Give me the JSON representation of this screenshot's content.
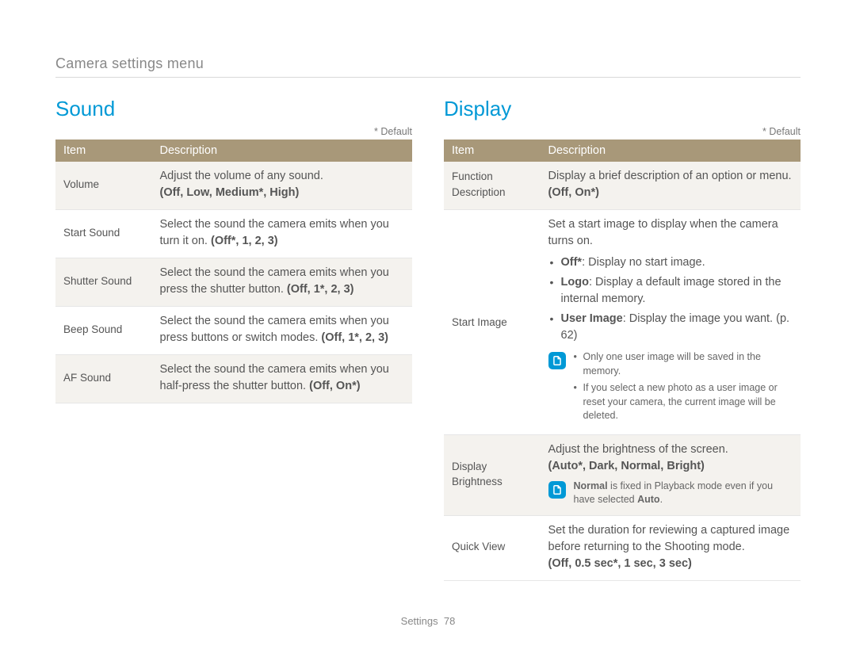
{
  "breadcrumb": "Camera settings menu",
  "default_label": "* Default",
  "headers": {
    "item": "Item",
    "desc": "Description"
  },
  "sound": {
    "title": "Sound",
    "rows": [
      {
        "item": "Volume",
        "desc": "Adjust the volume of any sound.",
        "opts": "(Off, Low, Medium*, High)"
      },
      {
        "item": "Start Sound",
        "desc": "Select the sound the camera emits when you turn it on. ",
        "opts_inline": "(Off*, 1, 2, 3)"
      },
      {
        "item": "Shutter Sound",
        "desc": "Select the sound the camera emits when you press the shutter button. ",
        "opts_inline": "(Off, 1*, 2, 3)"
      },
      {
        "item": "Beep Sound",
        "desc": "Select the sound the camera emits when you press buttons or switch modes. ",
        "opts_inline": "(Off, 1*, 2, 3)"
      },
      {
        "item": "AF Sound",
        "desc": "Select the sound the camera emits when you half-press the shutter button. ",
        "opts_inline": "(Off, On*)"
      }
    ]
  },
  "display": {
    "title": "Display",
    "func_desc": {
      "item": "Function Description",
      "desc": "Display a brief description of an option or menu.",
      "opts": "(Off, On*)"
    },
    "start_image": {
      "item": "Start Image",
      "intro": "Set a start image to display when the camera turns on.",
      "b1_label": "Off*",
      "b1_text": ": Display no start image.",
      "b2_label": "Logo",
      "b2_text": ": Display a default image stored in the internal memory.",
      "b3_label": "User Image",
      "b3_text": ": Display the image you want. (p. 62)",
      "n1": "Only one user image will be saved in the memory.",
      "n2": "If you select a new photo as a user image or reset your camera, the current image will be deleted."
    },
    "brightness": {
      "item": "Display Brightness",
      "desc": "Adjust the brightness of the screen.",
      "opts": "(Auto*, Dark, Normal, Bright)",
      "note_pre": "Normal",
      "note_mid": " is fixed in Playback mode even if you have selected ",
      "note_post": "Auto",
      "note_end": "."
    },
    "quickview": {
      "item": "Quick View",
      "desc": "Set the duration for reviewing a captured image before returning to the Shooting mode.",
      "opts": "(Off, 0.5 sec*, 1 sec, 3 sec)"
    }
  },
  "footer": {
    "section": "Settings",
    "page": "78"
  }
}
